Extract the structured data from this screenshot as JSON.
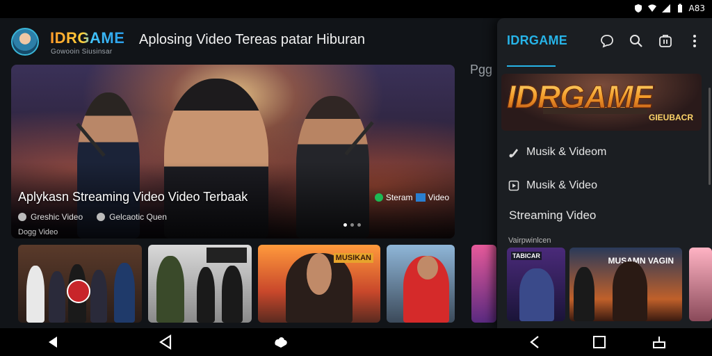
{
  "status_bar": {
    "time": "A83"
  },
  "header": {
    "brand": "IDRGAME",
    "brand_subtitle": "Gowooin Siusinsar",
    "page_title": "Aplosing Video Tereas patar Hiburan"
  },
  "hero": {
    "title": "Aplykasn Streaming Video Video Terbaak",
    "meta": [
      "Greshic Video",
      "Gelcaotic Quen"
    ],
    "tag_text": "Steram",
    "tag_text2": "Video",
    "slides": 3,
    "active_slide": 1
  },
  "peek_label": "Pgg",
  "section_label": "Dogg Video",
  "thumbnails": [
    {
      "badge": ""
    },
    {
      "badge": ""
    },
    {
      "badge": "MUSIKAN"
    },
    {
      "badge": ""
    },
    {
      "badge": ""
    }
  ],
  "drawer": {
    "brand": "IDRGAME",
    "banner_logo": "IDRGAME",
    "banner_sub": "GIEUBACR",
    "menu": [
      {
        "label": "Musik & Videom",
        "icon": "music-note-icon"
      },
      {
        "label": "Musik & Video",
        "icon": "play-square-icon"
      },
      {
        "label": "Streaming Video",
        "icon": ""
      }
    ],
    "section_label": "Vairpwinlcen",
    "thumb1_label": "TABICAR",
    "thumb2_label": "MUSAMN VAGIN"
  },
  "icons": {
    "drawer": [
      "chat-icon",
      "search-icon",
      "store-icon",
      "more-vertical-icon"
    ],
    "nav": [
      "back-icon",
      "nav-shield-icon",
      "home-cloud-icon",
      "back-alt-icon",
      "recents-icon",
      "cast-icon"
    ]
  },
  "colors": {
    "accent": "#27b4e8",
    "brand_orange": "#ff9a2a",
    "background": "#111418"
  }
}
